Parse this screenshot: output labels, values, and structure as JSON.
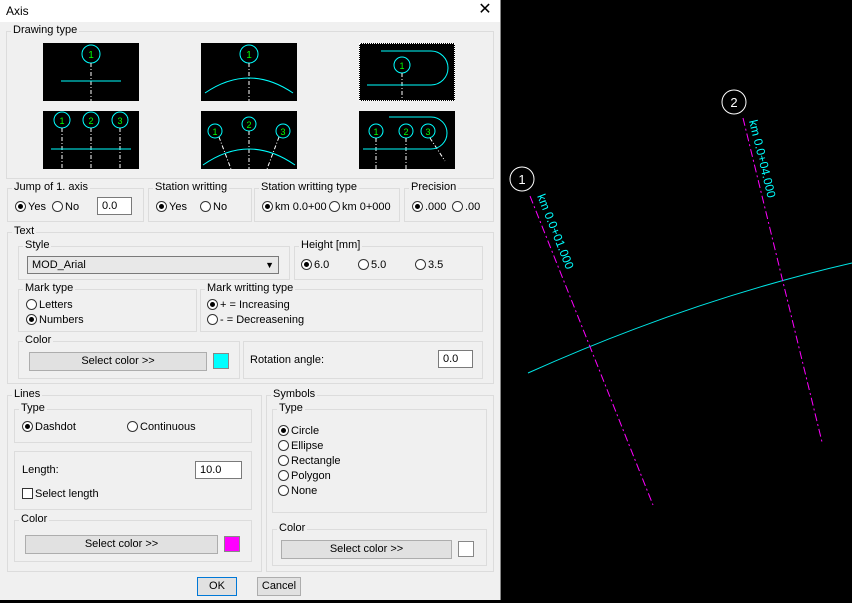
{
  "window": {
    "title": "Axis"
  },
  "drawing_type": {
    "label": "Drawing type"
  },
  "jump": {
    "label": "Jump of 1. axis",
    "yes": "Yes",
    "no": "No",
    "value": "0.0"
  },
  "station_writting": {
    "label": "Station writting",
    "yes": "Yes",
    "no": "No"
  },
  "station_type": {
    "label": "Station writting type",
    "opt1": "km 0.0+00",
    "opt2": "km 0+000"
  },
  "precision": {
    "label": "Precision",
    "opt1": ".000",
    "opt2": ".00"
  },
  "text": {
    "label": "Text",
    "style_label": "Style",
    "style_value": "MOD_Arial",
    "height_label": "Height [mm]",
    "heights": [
      "6.0",
      "5.0",
      "3.5"
    ],
    "mark_type_label": "Mark type",
    "mark_letters": "Letters",
    "mark_numbers": "Numbers",
    "mark_writting_label": "Mark writting type",
    "increasing": "+ = Increasing",
    "decreasing": "- = Decreasening",
    "color_label": "Color",
    "select_color": "Select color >>",
    "color": "#00ffff",
    "rotation_label": "Rotation angle:",
    "rotation_value": "0.0"
  },
  "lines": {
    "label": "Lines",
    "type_label": "Type",
    "dashdot": "Dashdot",
    "continuous": "Continuous",
    "length_label": "Length:",
    "length_value": "10.0",
    "select_length": "Select length",
    "color_label": "Color",
    "select_color": "Select color >>",
    "color": "#ff00ff"
  },
  "symbols": {
    "label": "Symbols",
    "type_label": "Type",
    "options": [
      "Circle",
      "Ellipse",
      "Rectangle",
      "Polygon",
      "None"
    ],
    "color_label": "Color",
    "select_color": "Select color >>",
    "color": "#ffffff"
  },
  "buttons": {
    "ok": "OK",
    "cancel": "Cancel"
  },
  "preview": {
    "axis1_number": "1",
    "axis1_station": "km 0.0+01.000",
    "axis2_number": "2",
    "axis2_station": "km 0.0+04.000"
  },
  "colors": {
    "cyan": "#00ffff",
    "magenta": "#ff00ff",
    "dialog_bg": "#f0f0f0"
  }
}
